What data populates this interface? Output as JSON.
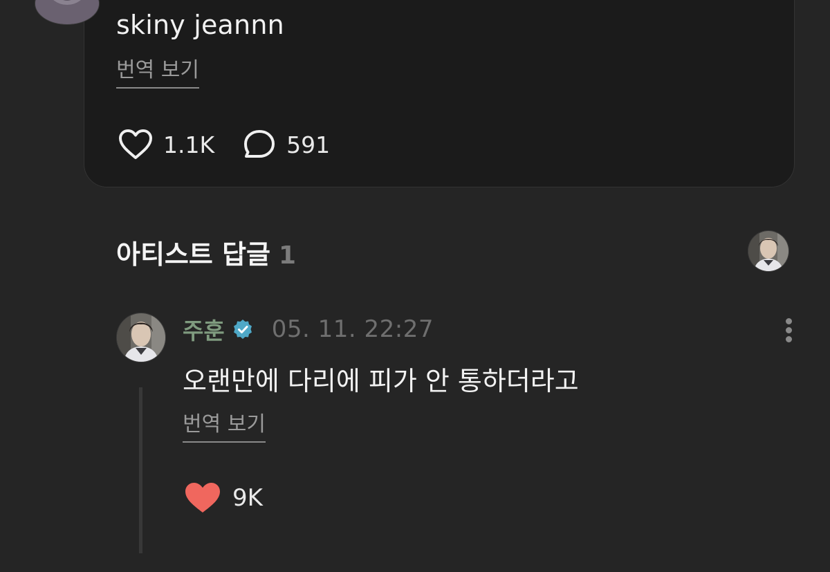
{
  "post": {
    "text": "skiny jeannn",
    "translate_label": "번역 보기",
    "likes": "1.1K",
    "comments": "591",
    "icons": {
      "like": "heart-outline-icon",
      "comment": "speech-bubble-icon"
    }
  },
  "artist_replies": {
    "title": "아티스트 답글",
    "count": "1"
  },
  "reply": {
    "author": "주훈",
    "verified_icon": "verified-badge-icon",
    "timestamp": "05. 11. 22:27",
    "text": "오랜만에 다리에 피가 안 통하더라고",
    "translate_label": "번역 보기",
    "likes": "9K",
    "colors": {
      "author": "#7f9b7f",
      "verified": "#4fa8c7",
      "liked_heart": "#f0675e"
    }
  },
  "colors": {
    "background": "#252525",
    "card": "#1b1b1b",
    "text": "#f2f2f2",
    "muted": "#9a9a9a"
  }
}
